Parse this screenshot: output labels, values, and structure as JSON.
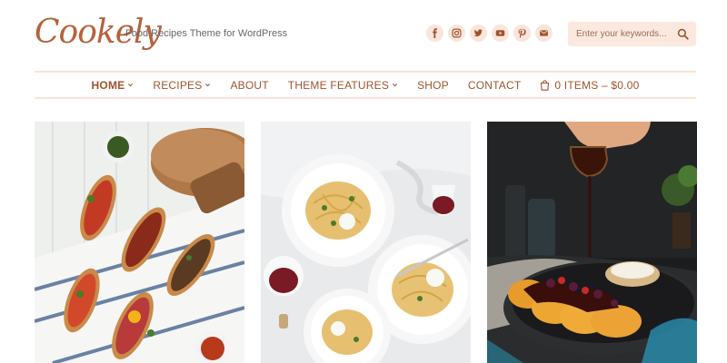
{
  "header": {
    "logo": "Cookely",
    "tagline": "Food Recipes Theme for WordPress"
  },
  "socials": [
    {
      "icon": "facebook-icon",
      "glyph": "f"
    },
    {
      "icon": "instagram-icon",
      "glyph": "ig"
    },
    {
      "icon": "twitter-icon",
      "glyph": "tw"
    },
    {
      "icon": "youtube-icon",
      "glyph": "yt"
    },
    {
      "icon": "pinterest-icon",
      "glyph": "p"
    },
    {
      "icon": "email-icon",
      "glyph": "@"
    }
  ],
  "search": {
    "placeholder": "Enter your keywords..."
  },
  "nav": {
    "home": "HOME",
    "recipes": "RECIPES",
    "about": "ABOUT",
    "features": "THEME FEATURES",
    "shop": "SHOP",
    "contact": "CONTACT",
    "cart": "0 ITEMS – $0.00"
  },
  "colors": {
    "accent": "#b5623a",
    "nav_text": "#a0532d",
    "social_bg": "#f8e6dc",
    "search_bg": "#fbe9df"
  },
  "cards": [
    {
      "image": "bruschetta-photo"
    },
    {
      "image": "pasta-wine-photo"
    },
    {
      "image": "pancakes-syrup-photo"
    }
  ]
}
